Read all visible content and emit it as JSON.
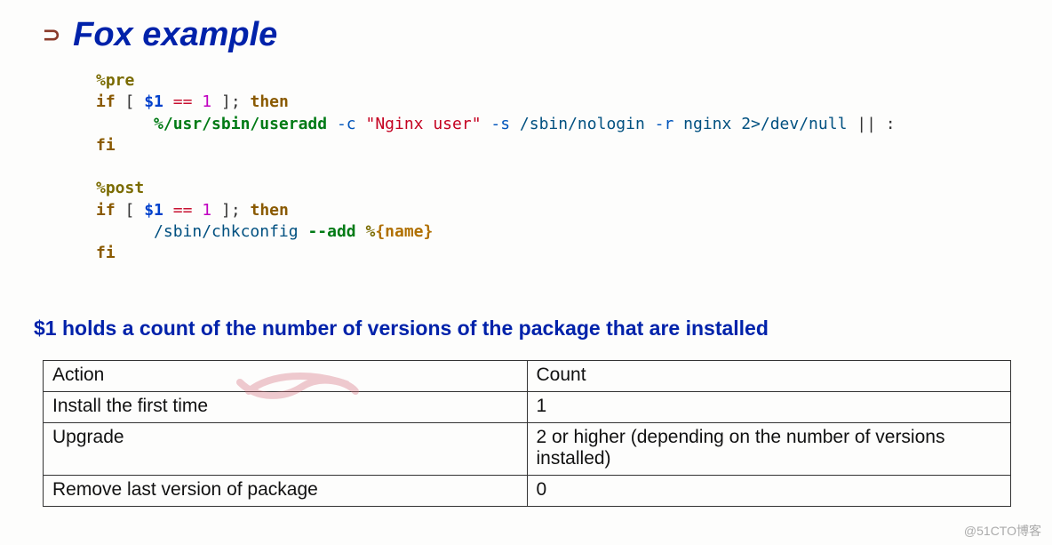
{
  "title": "Fox example",
  "code": {
    "pre": {
      "macro": "%pre",
      "if_open": "if",
      "lb": "[",
      "var": "$1",
      "eq": "==",
      "one": "1",
      "rb": "]",
      "semi": ";",
      "then": "then",
      "path_useradd": "%/usr/sbin/useradd",
      "flag_c": "-c",
      "str_user": "\"Nginx user\"",
      "flag_s": "-s",
      "path_nologin": "/sbin/nologin",
      "flag_r": "-r",
      "nginx": "nginx",
      "redir": "2>/dev/null",
      "orcolon": "|| :",
      "fi": "fi"
    },
    "post": {
      "macro": "%post",
      "if_open": "if",
      "lb": "[",
      "var": "$1",
      "eq": "==",
      "one": "1",
      "rb": "]",
      "semi": ";",
      "then": "then",
      "path_chk": "/sbin/chkconfig",
      "flag_add": "--add",
      "pct": "%",
      "name": "{name}",
      "fi": "fi"
    }
  },
  "subhead": "$1 holds a count of the number of versions of the package that are installed",
  "table": {
    "headers": {
      "action": "Action",
      "count": "Count"
    },
    "rows": [
      {
        "action": "Install the first time",
        "count": "1"
      },
      {
        "action": "Upgrade",
        "count": "2 or higher (depending on the number of versions installed)"
      },
      {
        "action": "Remove last version of package",
        "count": "0"
      }
    ]
  },
  "watermark": "@51CTO博客"
}
